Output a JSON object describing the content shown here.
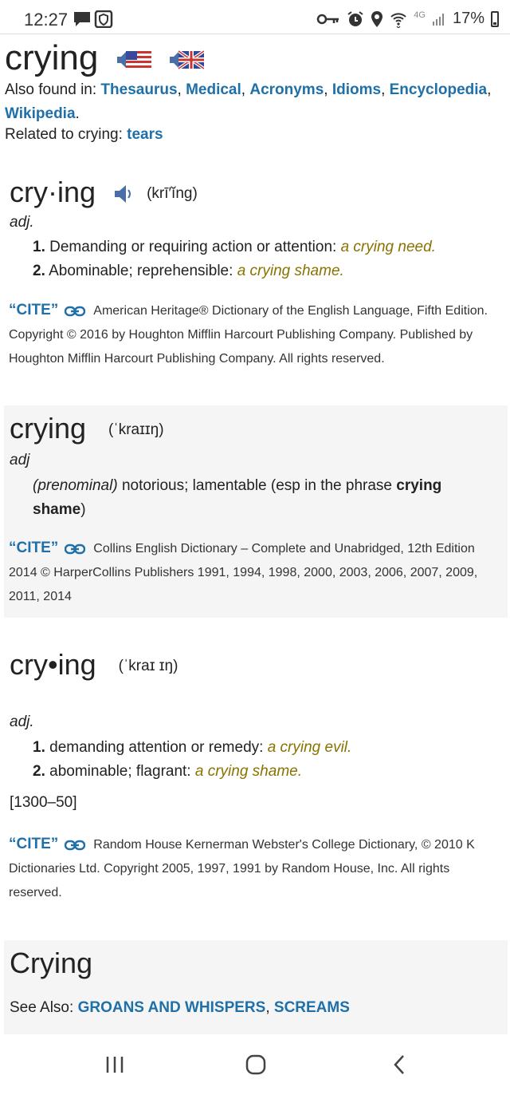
{
  "status": {
    "time": "12:27",
    "network": "4G",
    "battery": "17%"
  },
  "header": {
    "word": "crying",
    "also_label": "Also found in:",
    "also_links": [
      "Thesaurus",
      "Medical",
      "Acronyms",
      "Idioms",
      "Encyclopedia",
      "Wikipedia"
    ],
    "related_label": "Related to crying:",
    "related_link": "tears"
  },
  "entries": [
    {
      "head": "cry·ing",
      "pron": "(krī′ĭng)",
      "pos": "adj.",
      "senses": [
        {
          "num": "1.",
          "text": "Demanding or requiring action or attention:",
          "example": "a crying need."
        },
        {
          "num": "2.",
          "text": "Abominable; reprehensible:",
          "example": "a crying shame."
        }
      ],
      "cite_label": "“CITE”",
      "cite": "American Heritage® Dictionary of the English Language, Fifth Edition. Copyright © 2016 by Houghton Mifflin Harcourt Publishing Company. Published by Houghton Mifflin Harcourt Publishing Company. All rights reserved."
    },
    {
      "head": "crying",
      "pron": "(ˈkraɪɪŋ)",
      "pos": "adj",
      "sense_prefix": "(prenominal)",
      "sense_text": "notorious; lamentable (esp in the phrase",
      "sense_bold": "crying shame",
      "sense_suffix": ")",
      "cite_label": "“CITE”",
      "cite": "Collins English Dictionary – Complete and Unabridged, 12th Edition 2014 © HarperCollins Publishers 1991, 1994, 1998, 2000, 2003, 2006, 2007, 2009, 2011, 2014"
    },
    {
      "head": "cry•ing",
      "pron": "(ˈkraɪ ɪŋ)",
      "pos": "adj.",
      "senses": [
        {
          "num": "1.",
          "text": "demanding attention or remedy:",
          "example": "a crying evil."
        },
        {
          "num": "2.",
          "text": "abominable; flagrant:",
          "example": "a crying shame."
        }
      ],
      "date": "[1300–50]",
      "cite_label": "“CITE”",
      "cite": "Random House Kernerman Webster's College Dictionary, © 2010 K Dictionaries Ltd. Copyright 2005, 1997, 1991 by Random House, Inc. All rights reserved."
    }
  ],
  "encyclopedia": {
    "title": "Crying",
    "see_also_label": "See Also:",
    "links": [
      "GROANS AND WHISPERS",
      "SCREAMS"
    ]
  },
  "icons": {
    "statusbar": [
      "message-icon",
      "shield-icon",
      "key-icon",
      "alarm-icon",
      "location-icon",
      "wifi-icon",
      "signal-icon",
      "battery-icon"
    ],
    "navbar": [
      "recent-apps-icon",
      "home-icon",
      "back-icon"
    ]
  },
  "colors": {
    "link": "#1f6fa8",
    "example": "#8a7200",
    "shaded": "#f5f5f5"
  }
}
